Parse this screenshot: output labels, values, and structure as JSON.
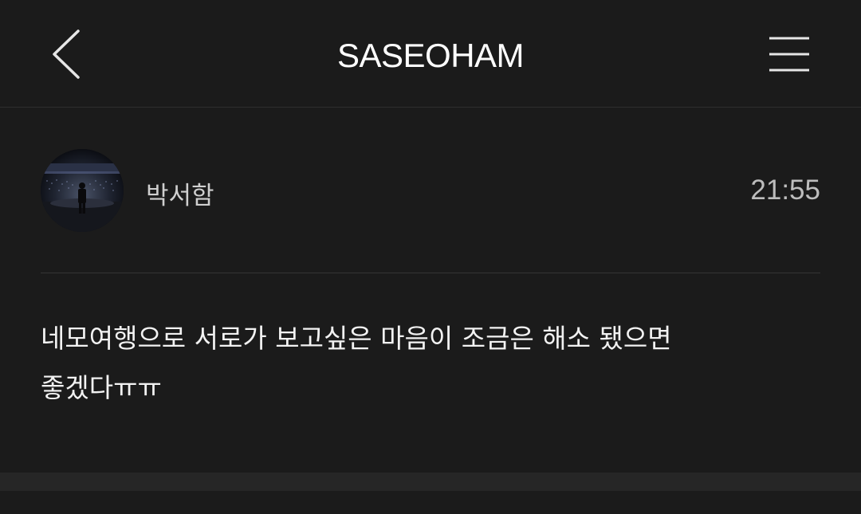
{
  "header": {
    "title": "SASEOHAM",
    "back_icon": "chevron-left-icon",
    "menu_icon": "hamburger-menu-icon"
  },
  "post": {
    "author": "박서함",
    "time": "21:55",
    "message": "네모여행으로 서로가 보고싶은 마음이 조금은 해소 됐으면\n좋겠다ㅠㅠ"
  },
  "colors": {
    "background": "#1b1b1b",
    "text_primary": "#f2f2f2",
    "text_secondary": "#cfcfcf",
    "divider": "#353535",
    "separator_band": "#262626"
  }
}
